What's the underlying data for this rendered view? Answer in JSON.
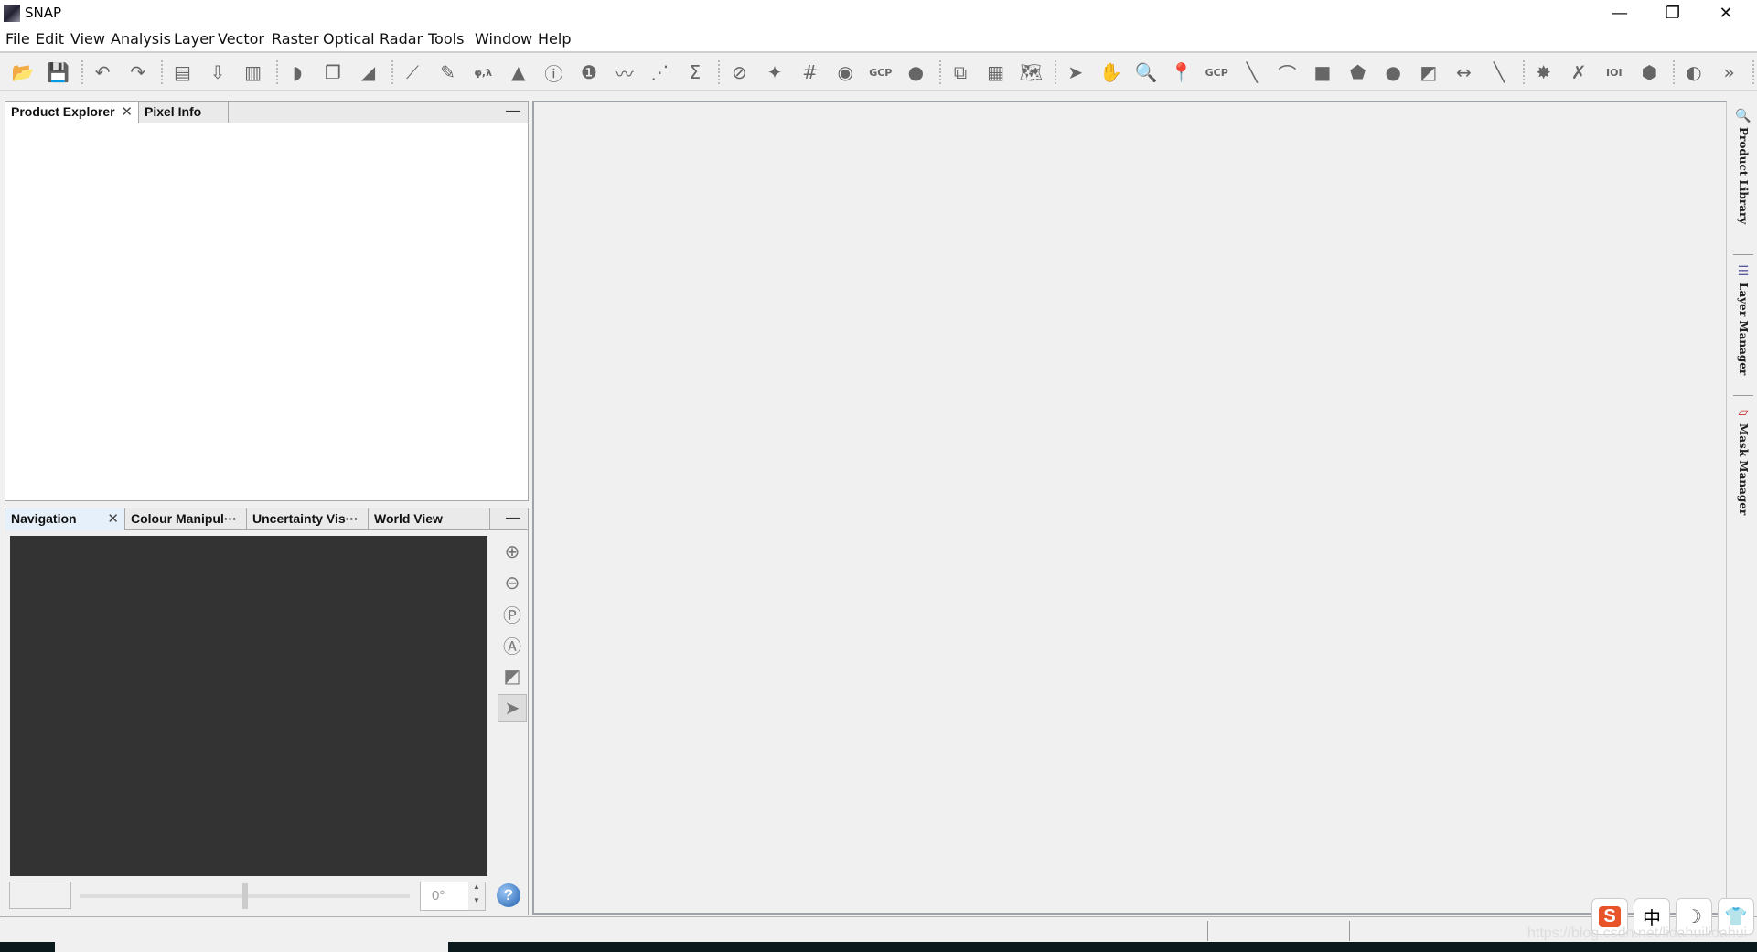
{
  "window": {
    "title": "SNAP",
    "minimize": "—",
    "restore": "❐",
    "close": "✕"
  },
  "menu": [
    "File",
    "Edit",
    "View",
    "Analysis",
    "Layer",
    "Vector",
    "Raster",
    "Optical",
    "Radar",
    "Tools",
    "Window",
    "Help"
  ],
  "search": {
    "placeholder": "",
    "value": "",
    "icon": "🔍▾"
  },
  "toolbar": [
    {
      "name": "open-product",
      "glyph": "📂"
    },
    {
      "name": "save-product",
      "glyph": "💾"
    },
    {
      "name": "sep"
    },
    {
      "name": "undo",
      "glyph": "↶"
    },
    {
      "name": "redo",
      "glyph": "↷"
    },
    {
      "name": "sep"
    },
    {
      "name": "new-product",
      "glyph": "▤"
    },
    {
      "name": "import-product",
      "glyph": "⇩"
    },
    {
      "name": "export-product",
      "glyph": "▥"
    },
    {
      "name": "sep"
    },
    {
      "name": "rgb-image",
      "glyph": "◗"
    },
    {
      "name": "image-view",
      "glyph": "❐"
    },
    {
      "name": "wave",
      "glyph": "◢"
    },
    {
      "name": "sep"
    },
    {
      "name": "profile-plot",
      "glyph": "⟋"
    },
    {
      "name": "band-maths",
      "glyph": "✎"
    },
    {
      "name": "geo-coding",
      "glyph": "φ,λ"
    },
    {
      "name": "histogram",
      "glyph": "▲"
    },
    {
      "name": "information",
      "glyph": "ⓘ"
    },
    {
      "name": "statistics",
      "glyph": "❶"
    },
    {
      "name": "spectrum",
      "glyph": "〰"
    },
    {
      "name": "scatter-plot",
      "glyph": "⋰"
    },
    {
      "name": "sum",
      "glyph": "Σ"
    },
    {
      "name": "sep"
    },
    {
      "name": "overlay-no-data",
      "glyph": "⊘"
    },
    {
      "name": "overlay-pins",
      "glyph": "✦"
    },
    {
      "name": "overlay-graticule",
      "glyph": "#"
    },
    {
      "name": "overlay-pin-manager",
      "glyph": "◉"
    },
    {
      "name": "overlay-gcp",
      "glyph": "GCP"
    },
    {
      "name": "overlay-world-map",
      "glyph": "●"
    },
    {
      "name": "sep"
    },
    {
      "name": "graph-builder",
      "glyph": "⧉"
    },
    {
      "name": "batch-processing",
      "glyph": "▦"
    },
    {
      "name": "world-map",
      "glyph": "🗺"
    },
    {
      "name": "sep"
    },
    {
      "name": "select-tool",
      "glyph": "➤"
    },
    {
      "name": "pan-tool",
      "glyph": "✋"
    },
    {
      "name": "zoom-tool",
      "glyph": "🔍"
    },
    {
      "name": "pin-placing-tool",
      "glyph": "📍"
    },
    {
      "name": "gcp-placing-tool",
      "glyph": "GCP"
    },
    {
      "name": "line-drawing-tool",
      "glyph": "╲"
    },
    {
      "name": "polyline-drawing-tool",
      "glyph": "⌒"
    },
    {
      "name": "rectangle-drawing-tool",
      "glyph": "■"
    },
    {
      "name": "polygon-drawing-tool",
      "glyph": "⬟"
    },
    {
      "name": "ellipse-drawing-tool",
      "glyph": "●"
    },
    {
      "name": "insert-figure-tool",
      "glyph": "◩"
    },
    {
      "name": "range-finder-tool",
      "glyph": "↔"
    },
    {
      "name": "magic-wand-tool",
      "glyph": "╲"
    },
    {
      "name": "sep"
    },
    {
      "name": "star-tool",
      "glyph": "✸"
    },
    {
      "name": "xy-tool",
      "glyph": "✗"
    },
    {
      "name": "binary-tool",
      "glyph": "IOI"
    },
    {
      "name": "cluster-tool",
      "glyph": "⬢"
    },
    {
      "name": "sep"
    },
    {
      "name": "color-manipulation",
      "glyph": "◐"
    },
    {
      "name": "more",
      "glyph": "»"
    },
    {
      "name": "sep"
    },
    {
      "name": "overflow",
      "glyph": "»"
    }
  ],
  "top_panel": {
    "tabs": [
      {
        "label": "Product Explorer",
        "closable": true
      },
      {
        "label": "Pixel Info",
        "closable": false
      }
    ],
    "minimize": "—",
    "close": "✕"
  },
  "bottom_panel": {
    "tabs": [
      {
        "label": "Navigation",
        "closable": true
      },
      {
        "label": "Colour Manipul···"
      },
      {
        "label": "Uncertainty Vis···"
      },
      {
        "label": "World View"
      }
    ],
    "minimize": "—",
    "close": "✕",
    "rotation_value": "0°",
    "slider_position": 0.5,
    "help": "?"
  },
  "right_sidebar": [
    {
      "label": "Product Library"
    },
    {
      "label": "Layer Manager"
    },
    {
      "label": "Mask Manager"
    }
  ],
  "ime": {
    "logo": "S",
    "lang": "中",
    "mode": "☽",
    "skin": "👕"
  },
  "watermark": "https://blog.csdn.net/lidahuilidahui"
}
